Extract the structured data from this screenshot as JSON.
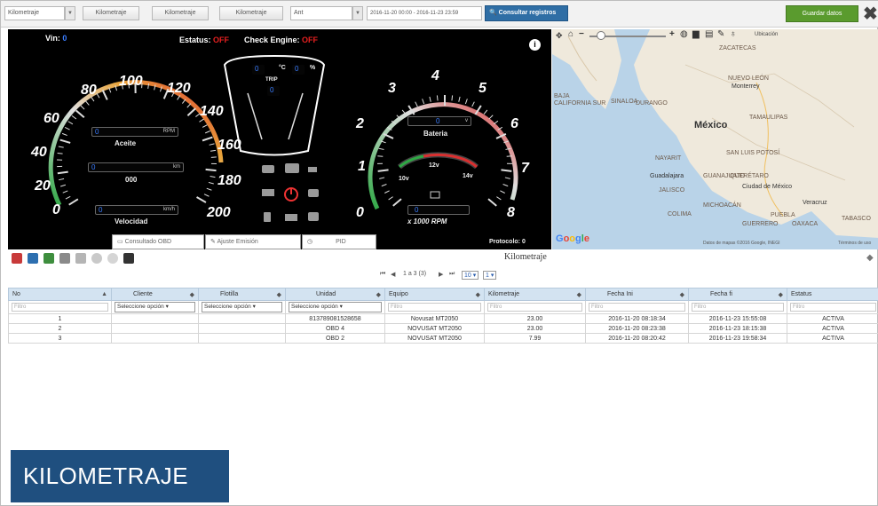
{
  "toolbar": {
    "field1": "Kilometraje",
    "field2": "Kilometraje",
    "field3": "Kilometraje",
    "field4": "Kilometraje",
    "field5": "Ant",
    "date_range": "2016-11-20 00:00 - 2016-11-23 23:59",
    "search_label": "Consultar registros",
    "green_label": "Guardar datos",
    "close_symbol": "✖"
  },
  "dashboard": {
    "vin_label": "Vin:",
    "vin_value": "0",
    "estatus_label": "Estatus:",
    "estatus_value": "OFF",
    "check_engine_label": "Check Engine:",
    "check_engine_value": "OFF",
    "info_symbol": "i",
    "speed_ticks": [
      "0",
      "20",
      "40",
      "60",
      "80",
      "100",
      "120",
      "140",
      "160",
      "180",
      "200"
    ],
    "rpm_ticks": [
      "0",
      "1",
      "2",
      "3",
      "4",
      "5",
      "6",
      "7",
      "8"
    ],
    "speedo": {
      "rpm_value": "0",
      "rpm_unit": "RPM",
      "aceite_label": "Aceite",
      "odo_value": "0",
      "odo_unit": "km",
      "odo_digits": "000",
      "vel_value": "0",
      "vel_unit": "km/h",
      "vel_label": "Velocidad"
    },
    "center": {
      "temp_value": "0",
      "temp_unit": "°C",
      "fuel_value": "0",
      "fuel_unit": "%",
      "trip_label": "TRIP",
      "trip_value": "0"
    },
    "tacho": {
      "bat_value": "0",
      "bat_unit": "v",
      "bat_label": "Bateria",
      "volt_12": "12v",
      "volt_10": "10v",
      "volt_14": "14v",
      "rpm_box": "0",
      "rpm_label": "x 1000 RPM"
    },
    "protocol": "Protocolo: 0",
    "tabs": [
      "Consultado OBD",
      "Ajuste Emisión",
      "PID"
    ]
  },
  "map": {
    "labels": [
      "ZACATECAS",
      "NUEVO LEÓN",
      "Monterrey",
      "BAJA",
      "CALIFORNIA SUR",
      "SINALOA",
      "DURANGO",
      "México",
      "TAMAULIPAS",
      "SAN LUIS POTOSÍ",
      "NAYARIT",
      "Guadalajara",
      "JALISCO",
      "GUANAJUATO",
      "QUERÉTARO",
      "Ciudad de México",
      "MICHOACÁN",
      "Veracruz",
      "COLIMA",
      "PUEBLA",
      "GUERRERO",
      "OAXACA",
      "TABASCO"
    ],
    "google_parts": [
      "G",
      "o",
      "o",
      "g",
      "l",
      "e"
    ],
    "attribution": "Datos de mapas ©2016 Google, INEGI",
    "terms": "Términos de uso",
    "zoom_plus": "+",
    "zoom_minus": "−",
    "tool_right": "Ubicación"
  },
  "section": {
    "title": "Kilometraje"
  },
  "pager": {
    "first": "⏮",
    "prev": "◀",
    "info": "1 a 3 (3)",
    "next": "▶",
    "last": "⏭",
    "per_page": "10 ▾",
    "page": "1 ▾"
  },
  "table": {
    "columns": [
      "No",
      "Cliente",
      "Flotilla",
      "Unidad",
      "Equipo",
      "Kilometraje",
      "Fecha Ini",
      "Fecha fi",
      "Estatus"
    ],
    "filters": [
      "Filtro",
      "Seleccione opción",
      "Seleccione opción",
      "Seleccione opción",
      "Filtro",
      "Filtro",
      "Filtro",
      "Filtro",
      "Filtro"
    ],
    "rows": [
      {
        "no": "1",
        "cliente": "",
        "flotilla": "",
        "unidad": "813789081528658",
        "equipo": "Novusat MT2050",
        "km": "23.00",
        "fini": "2016-11-20 08:18:34",
        "ffin": "2016-11-23 15:55:08",
        "estatus": "ACTIVA"
      },
      {
        "no": "2",
        "cliente": "",
        "flotilla": "",
        "unidad": "OBD 4",
        "equipo": "NOVUSAT MT2050",
        "km": "23.00",
        "fini": "2016-11-20 08:23:38",
        "ffin": "2016-11-23 18:15:38",
        "estatus": "ACTIVA"
      },
      {
        "no": "3",
        "cliente": "",
        "flotilla": "",
        "unidad": "OBD 2",
        "equipo": "NOVUSAT MT2050",
        "km": "7.99",
        "fini": "2016-11-20 08:20:42",
        "ffin": "2016-11-23 19:58:34",
        "estatus": "ACTIVA"
      }
    ]
  },
  "banner": {
    "text": "KILOMETRAJE"
  }
}
